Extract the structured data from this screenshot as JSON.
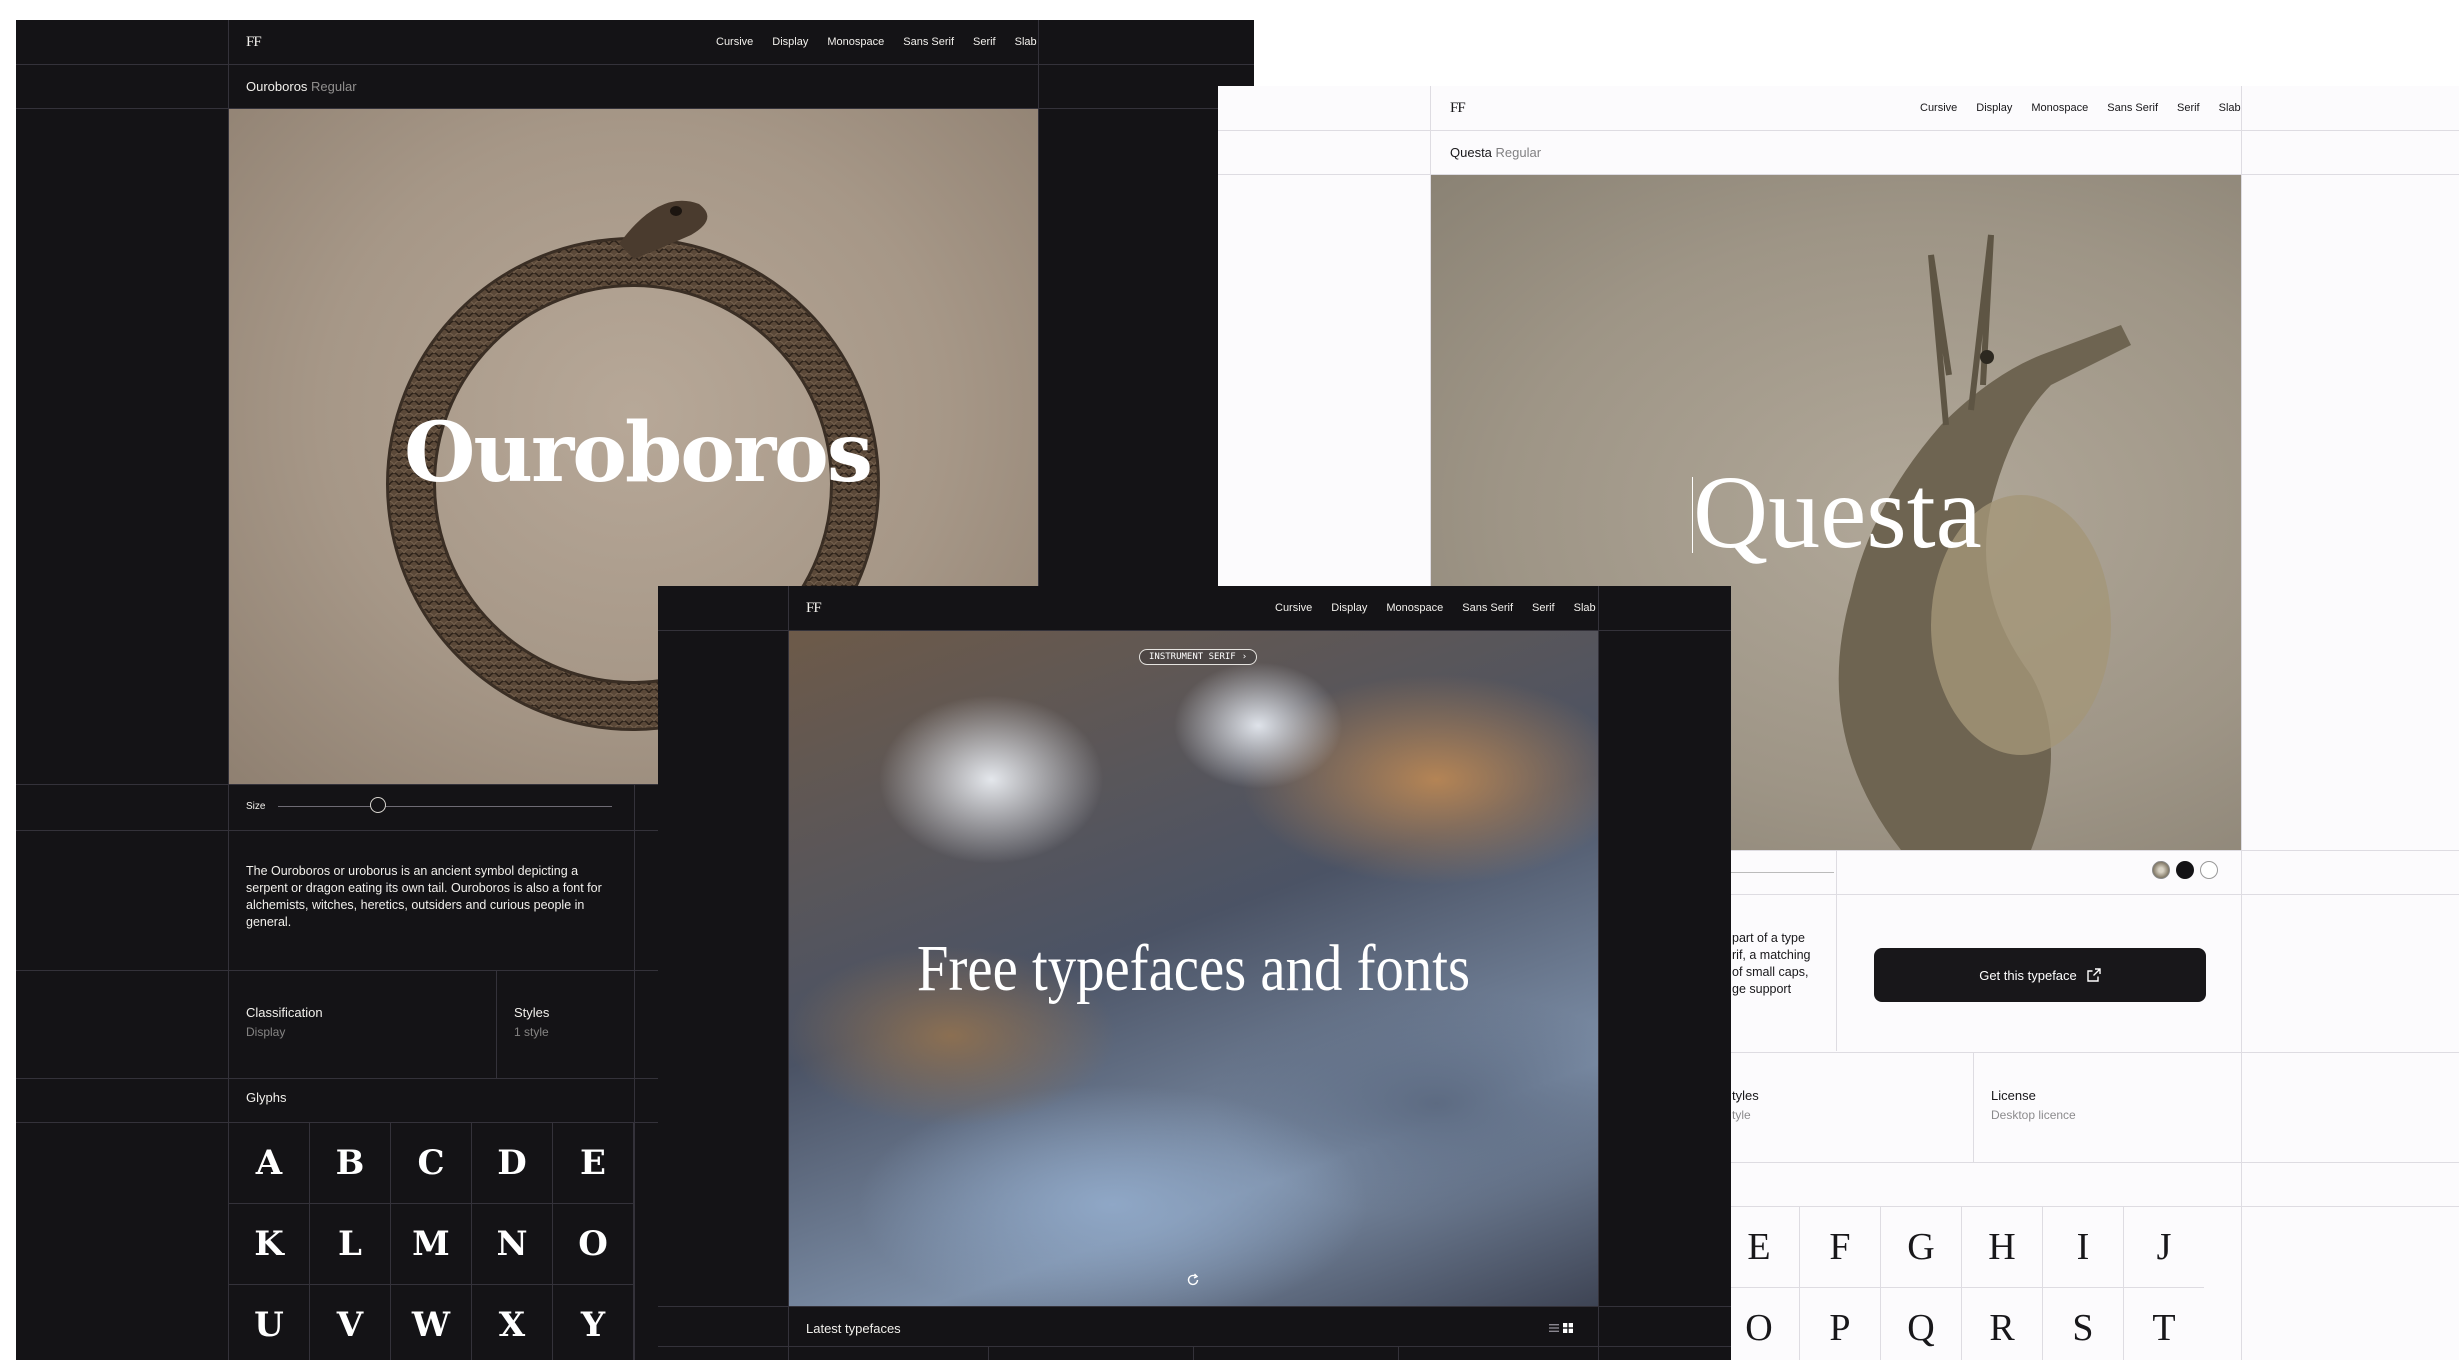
{
  "nav": {
    "logo": "FF",
    "items": [
      "Cursive",
      "Display",
      "Monospace",
      "Sans Serif",
      "Serif",
      "Slab"
    ]
  },
  "ouroboros": {
    "name": "Ouroboros",
    "weight": "Regular",
    "hero_title": "Ouroboros",
    "size_label": "Size",
    "size_value": 0.3,
    "description": "The Ouroboros or uroborus is an ancient symbol depicting a serpent or dragon eating its own tail. Ouroboros is also a font for alchemists, witches, heretics, outsiders and curious people in general.",
    "classification_label": "Classification",
    "classification_value": "Display",
    "styles_label": "Styles",
    "styles_value": "1 style",
    "glyphs_label": "Glyphs",
    "glyphs": [
      "A",
      "B",
      "C",
      "D",
      "E",
      "K",
      "L",
      "M",
      "N",
      "O",
      "U",
      "V",
      "W",
      "X",
      "Y"
    ]
  },
  "questa": {
    "name": "Questa",
    "weight": "Regular",
    "hero_title": "Questa",
    "description_fragment": [
      "part of a type",
      "rif, a matching",
      "of small caps,",
      "ge support"
    ],
    "cta_label": "Get this typeface",
    "styles_label_fragment": "tyles",
    "styles_value_fragment": "tyle",
    "license_label": "License",
    "license_value": "Desktop licence",
    "glyphs": [
      "E",
      "F",
      "G",
      "H",
      "I",
      "J",
      "O",
      "P",
      "Q",
      "R",
      "S",
      "T"
    ],
    "swatches": [
      "image",
      "#141316",
      "#ffffff"
    ]
  },
  "home": {
    "pill_label": "INSTRUMENT SERIF",
    "hero_title": "Free typefaces and fonts",
    "latest_label": "Latest typefaces"
  },
  "icons": {
    "external": "external-link-icon",
    "refresh": "refresh-icon",
    "list": "list-view-icon",
    "grid": "grid-view-icon",
    "chevron": "chevron-right-icon"
  }
}
